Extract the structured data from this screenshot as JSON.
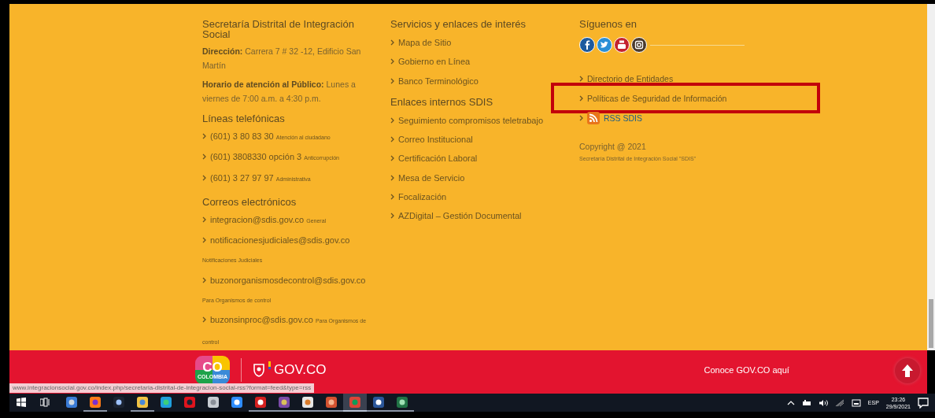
{
  "organization": {
    "title": "Secretaría Distrital de Integración Social",
    "address": "**Dirección:** Carrera 7 # 32 -12, Edificio San Martín",
    "hours": "**Horario de atención al Público:** Lunes a viernes de 7:00 a.m. a 4:30 p.m.",
    "phones_title": "Líneas telefónicas",
    "phones": [
      {
        "value": "(601) 3 80 83 30",
        "note": "Atención al ciudadano"
      },
      {
        "value": "(601) 3808330 opción 3",
        "note": "Anticorrupción"
      },
      {
        "value": "(601) 3 27 97 97",
        "note": "Administrativa"
      }
    ],
    "emails_title": "Correos electrónicos",
    "emails": [
      {
        "value": "integracion@sdis.gov.co",
        "note": "General"
      },
      {
        "value": "notificacionesjudiciales@sdis.gov.co",
        "note": "Notificaciones Judiciales"
      },
      {
        "value": "buzonorganismosdecontrol@sdis.gov.co",
        "note": "Para Organismos de control"
      },
      {
        "value": "buzonsinproc@sdis.gov.co",
        "note": "Para Organismos de control"
      }
    ]
  },
  "services": [
    {
      "title": "Servicios y enlaces de interés",
      "links": [
        "Mapa de Sitio",
        "Gobierno en Línea",
        "Banco Terminológico"
      ]
    },
    {
      "title": "Enlaces internos SDIS",
      "links": [
        "Seguimiento compromisos teletrabajo",
        "Correo Institucional",
        "Certificación Laboral",
        "Mesa de Servicio",
        "Focalización",
        "AZDigital – Gestión Documental"
      ]
    }
  ],
  "follow": {
    "title": "Síguenos en",
    "links": [
      {
        "label": "Directorio de Entidades",
        "kind": "link",
        "highlighted": false
      },
      {
        "label": "Políticas de Seguridad de Información",
        "kind": "link",
        "highlighted": true
      },
      {
        "label": "RSS SDIS",
        "kind": "rss",
        "highlighted": false
      }
    ],
    "copyright": "Copyright @ 2021",
    "owner": "Secretaría Distrital de Integración Social \"SDIS\""
  },
  "gov_band": {
    "logo_text": "CO",
    "logo_caption": "COLOMBIA",
    "brand": "GOV.CO",
    "link": "Conoce GOV.CO aquí"
  },
  "status_url": "www.integracionsocial.gov.co/index.php/secretaria-distrital-de-integracion-social-rss?format=feed&type=rss",
  "taskbar": {
    "apps": [
      {
        "kind": "computer",
        "running": false,
        "selected": false
      },
      {
        "kind": "firefox",
        "running": true,
        "selected": false
      },
      {
        "kind": "cortana",
        "running": false,
        "selected": false
      },
      {
        "kind": "explorer",
        "running": true,
        "selected": false
      },
      {
        "kind": "edge",
        "running": false,
        "selected": false
      },
      {
        "kind": "opera",
        "running": false,
        "selected": false
      },
      {
        "kind": "app",
        "running": false,
        "selected": false
      },
      {
        "kind": "zoom",
        "running": false,
        "selected": false
      },
      {
        "kind": "acrobat",
        "running": true,
        "selected": false
      },
      {
        "kind": "winrar",
        "running": true,
        "selected": false
      },
      {
        "kind": "paint",
        "running": true,
        "selected": false
      },
      {
        "kind": "powerpoint",
        "running": true,
        "selected": false
      },
      {
        "kind": "chrome",
        "running": true,
        "selected": true
      },
      {
        "kind": "word",
        "running": true,
        "selected": false
      },
      {
        "kind": "excel",
        "running": true,
        "selected": false
      }
    ],
    "language": "ESP",
    "time": "23:26",
    "date": "29/9/2021"
  }
}
